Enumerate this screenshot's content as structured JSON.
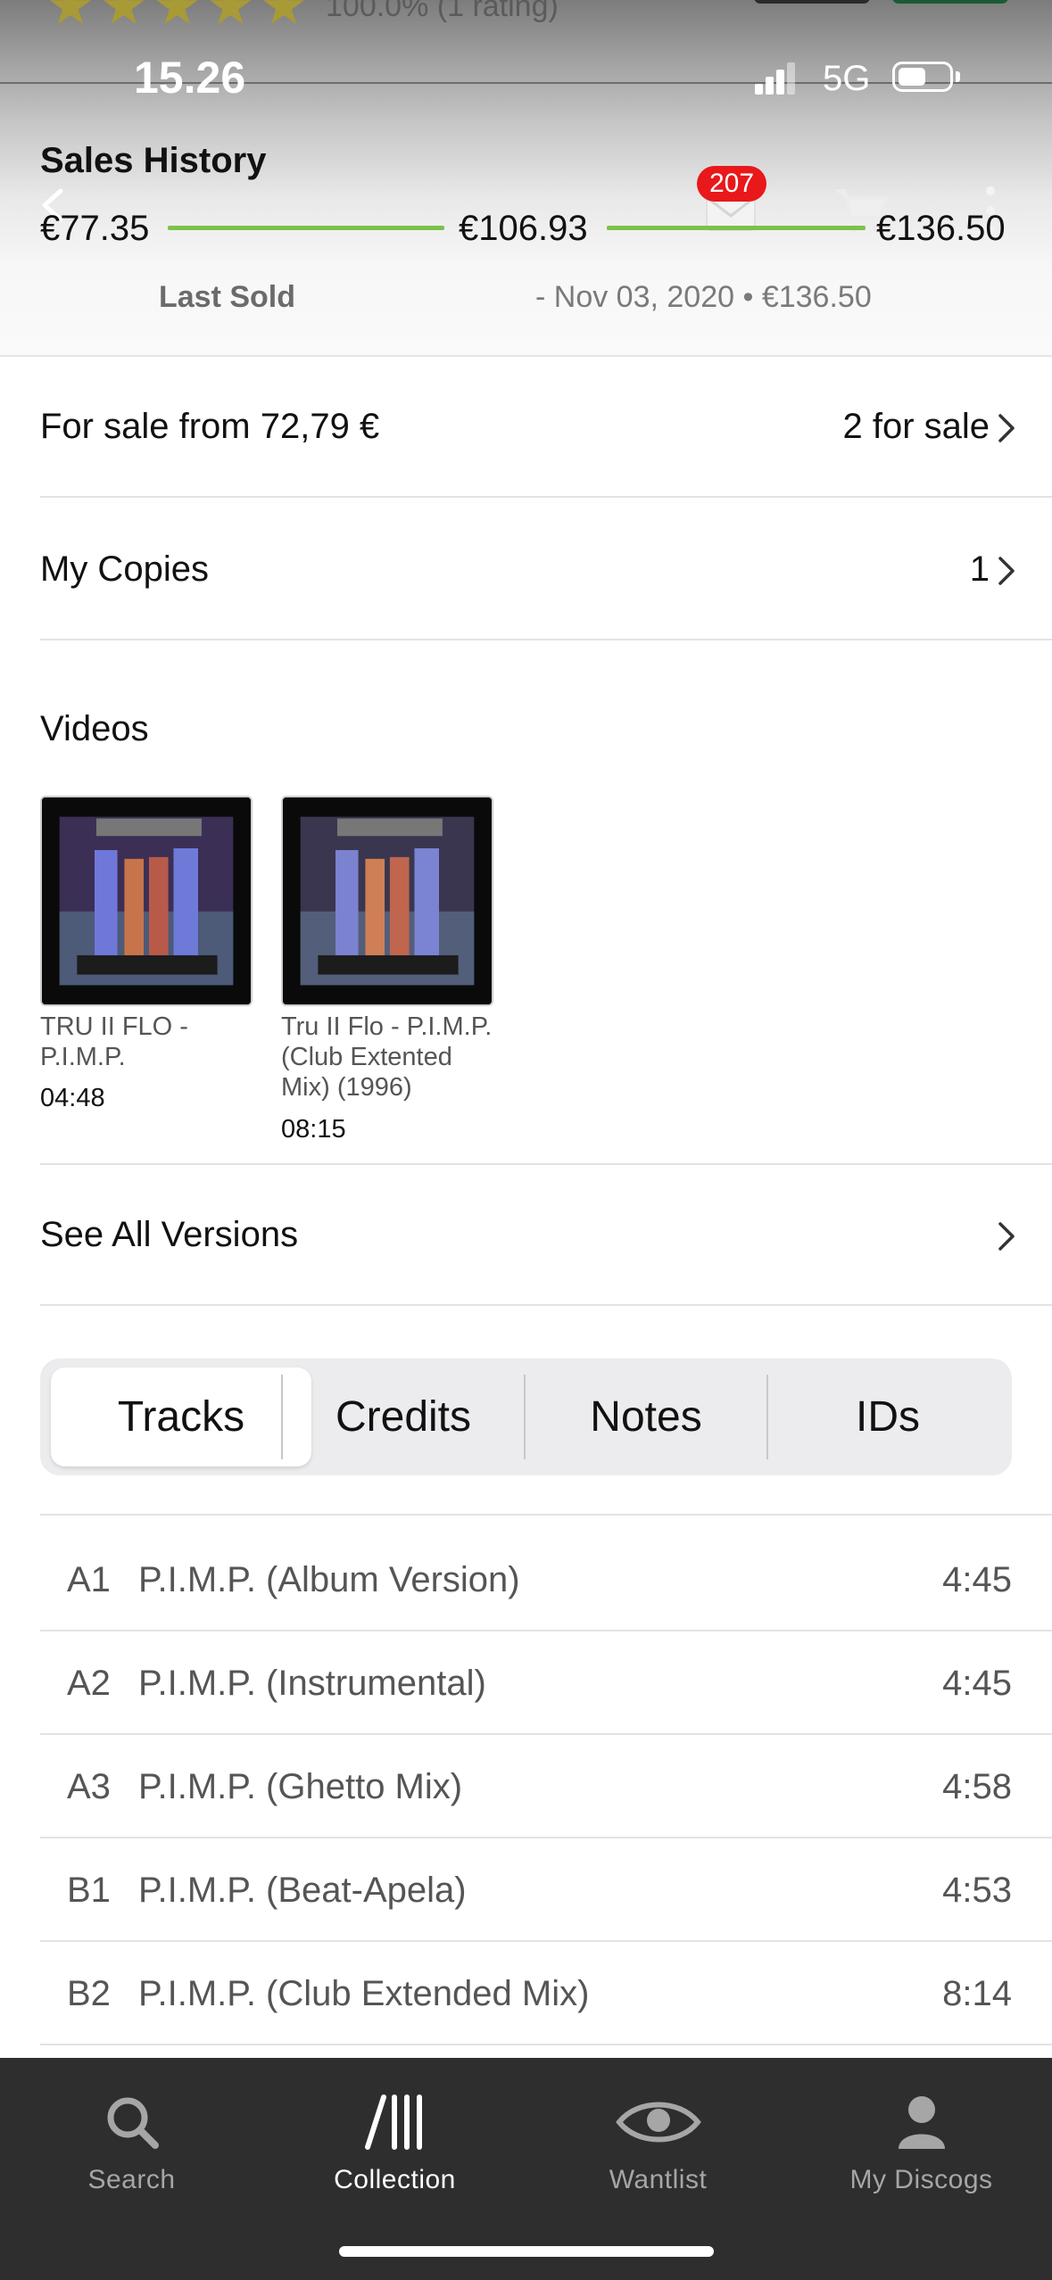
{
  "peek": {
    "rating_text": "100.0% (1 rating)"
  },
  "status_bar": {
    "time": "15.26",
    "network": "5G"
  },
  "nav": {
    "badge_count": "207"
  },
  "sales_history": {
    "title": "Sales History",
    "low": "€77.35",
    "median": "€106.93",
    "high": "€136.50",
    "last_sold_label": "Last Sold",
    "last_sold_value": "- Nov 03, 2020 • €136.50"
  },
  "for_sale": {
    "label": "For sale from 72,79 €",
    "value": "2 for sale"
  },
  "my_copies": {
    "label": "My Copies",
    "value": "1"
  },
  "videos": {
    "title": "Videos",
    "items": [
      {
        "title": "TRU II FLO - P.I.M.P.",
        "duration": "04:48"
      },
      {
        "title": "Tru II Flo - P.I.M.P. (Club Extented Mix) (1996)",
        "duration": "08:15"
      }
    ]
  },
  "see_all_versions": {
    "label": "See All Versions"
  },
  "segments": [
    "Tracks",
    "Credits",
    "Notes",
    "IDs"
  ],
  "active_segment": "Tracks",
  "tracks": [
    {
      "pos": "A1",
      "title": "P.I.M.P. (Album Version)",
      "duration": "4:45"
    },
    {
      "pos": "A2",
      "title": "P.I.M.P. (Instrumental)",
      "duration": "4:45"
    },
    {
      "pos": "A3",
      "title": "P.I.M.P. (Ghetto Mix)",
      "duration": "4:58"
    },
    {
      "pos": "B1",
      "title": "P.I.M.P. (Beat-Apela)",
      "duration": "4:53"
    },
    {
      "pos": "B2",
      "title": "P.I.M.P. (Club Extended Mix)",
      "duration": "8:14"
    }
  ],
  "tab_bar": [
    {
      "label": "Search",
      "icon": "search-icon"
    },
    {
      "label": "Collection",
      "icon": "collection-icon"
    },
    {
      "label": "Wantlist",
      "icon": "eye-icon"
    },
    {
      "label": "My Discogs",
      "icon": "profile-icon"
    }
  ],
  "active_tab": "Collection",
  "colors": {
    "accent_green": "#7cc24a",
    "badge_red": "#e8181b",
    "tabbar_bg": "#2e2e2e"
  }
}
